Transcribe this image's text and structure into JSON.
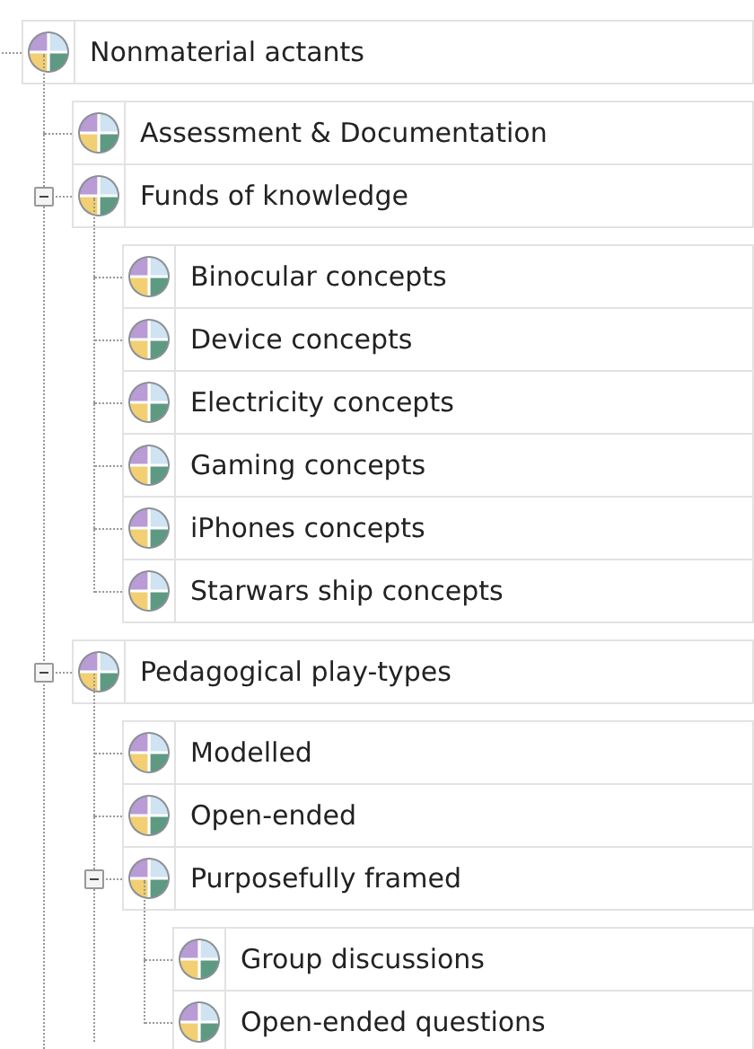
{
  "tree": {
    "label": "Nonmaterial actants",
    "children": [
      {
        "label": "Assessment & Documentation"
      },
      {
        "label": "Funds of knowledge",
        "expanded": true,
        "children": [
          {
            "label": "Binocular concepts"
          },
          {
            "label": "Device concepts"
          },
          {
            "label": "Electricity concepts"
          },
          {
            "label": "Gaming concepts"
          },
          {
            "label": "iPhones concepts"
          },
          {
            "label": "Starwars ship concepts"
          }
        ]
      },
      {
        "label": "Pedagogical play-types",
        "expanded": true,
        "children": [
          {
            "label": "Modelled"
          },
          {
            "label": "Open-ended"
          },
          {
            "label": "Purposefully framed",
            "expanded": true,
            "children": [
              {
                "label": "Group discussions"
              },
              {
                "label": "Open-ended questions"
              }
            ]
          }
        ]
      }
    ]
  }
}
